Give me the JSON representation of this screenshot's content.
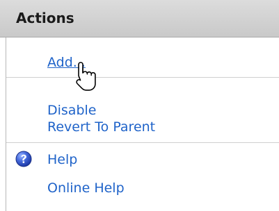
{
  "panel": {
    "title": "Actions",
    "items": [
      {
        "label": "Add..."
      },
      {
        "label": "Disable"
      },
      {
        "label": "Revert To Parent"
      },
      {
        "label": "Help"
      },
      {
        "label": "Online Help"
      }
    ]
  },
  "icons": {
    "help": "help-icon",
    "cursor": "hand-pointer-icon"
  },
  "colors": {
    "link": "#1f63c9",
    "header_bg": "#cfcfcf",
    "help_icon": "#2d4fc8"
  }
}
